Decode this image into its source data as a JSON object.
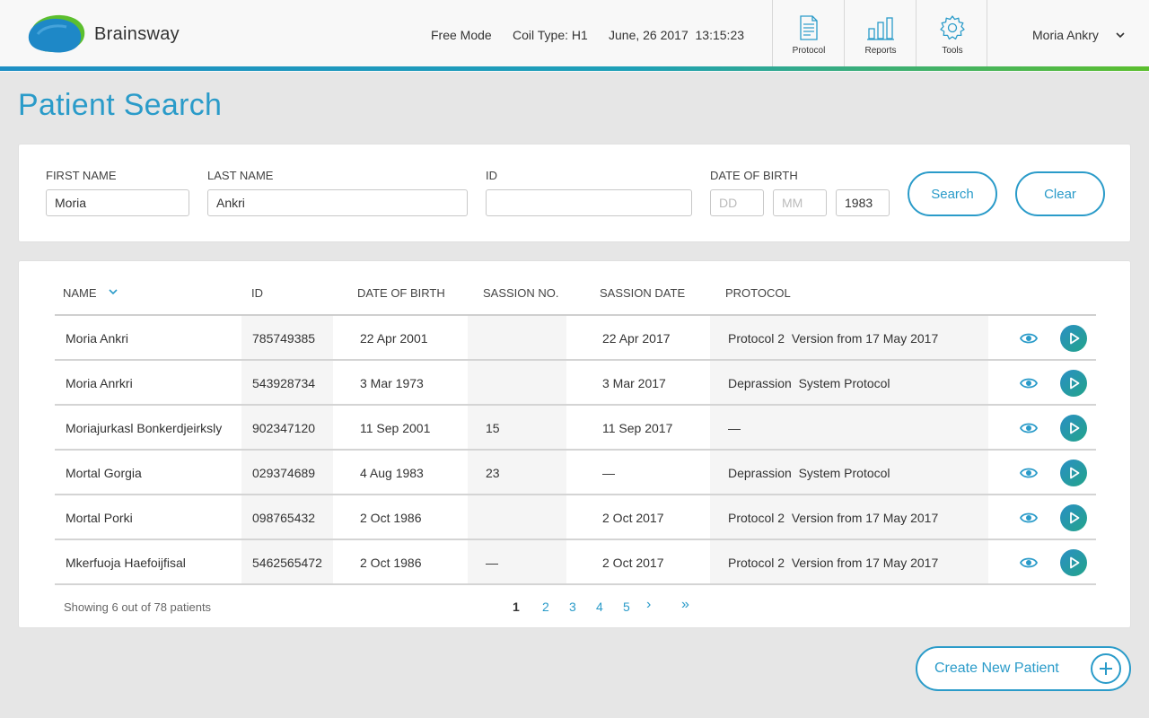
{
  "header": {
    "brand": "Brainsway",
    "mode": "Free Mode",
    "coil_type": "Coil Type: H1",
    "datetime": "June, 26 2017  13:15:23",
    "nav": [
      {
        "label": "Protocol",
        "icon": "document-icon"
      },
      {
        "label": "Reports",
        "icon": "bar-chart-icon"
      },
      {
        "label": "Tools",
        "icon": "gear-icon"
      }
    ],
    "user": "Moria Ankry"
  },
  "page_title": "Patient Search",
  "search": {
    "first_name": {
      "label": "FIRST NAME",
      "value": "Moria"
    },
    "last_name": {
      "label": "LAST NAME",
      "value": "Ankri"
    },
    "id": {
      "label": "ID",
      "value": ""
    },
    "dob": {
      "label": "DATE OF BIRTH",
      "dd_placeholder": "DD",
      "mm_placeholder": "MM",
      "year": "1983"
    },
    "search_label": "Search",
    "clear_label": "Clear"
  },
  "table": {
    "columns": [
      "NAME",
      "ID",
      "DATE OF BIRTH",
      "SASSION NO.",
      "SASSION DATE",
      "PROTOCOL"
    ],
    "rows": [
      {
        "name": "Moria Ankri",
        "id": "785749385",
        "dob": "22 Apr 2001",
        "session_no": "",
        "session_date": "22 Apr 2017",
        "protocol": "Protocol 2  Version from 17 May 2017"
      },
      {
        "name": "Moria Anrkri",
        "id": "543928734",
        "dob": "3 Mar 1973",
        "session_no": "",
        "session_date": "3 Mar 2017",
        "protocol": "Deprassion  System Protocol"
      },
      {
        "name": "Moriajurkasl Bonkerdjeirksly",
        "id": "902347120",
        "dob": "11 Sep 2001",
        "session_no": "15",
        "session_date": "11 Sep 2017",
        "protocol": "—"
      },
      {
        "name": "Mortal Gorgia",
        "id": "029374689",
        "dob": "4 Aug 1983",
        "session_no": "23",
        "session_date": "—",
        "protocol": "Deprassion  System Protocol"
      },
      {
        "name": "Mortal Porki",
        "id": "098765432",
        "dob": "2 Oct 1986",
        "session_no": "",
        "session_date": "2 Oct 2017",
        "protocol": "Protocol 2  Version from 17 May 2017"
      },
      {
        "name": "Mkerfuoja Haefoijfisal",
        "id": "5462565472",
        "dob": "2 Oct 1986",
        "session_no": "—",
        "session_date": "2 Oct 2017",
        "protocol": "Protocol 2  Version from 17 May 2017"
      }
    ]
  },
  "pagination": {
    "showing": "Showing 6 out of 78 patients",
    "pages": [
      "1",
      "2",
      "3",
      "4",
      "5"
    ],
    "current": "1",
    "next": "›",
    "last": "»"
  },
  "create_label": "Create New Patient",
  "colors": {
    "accent": "#2a9bc9",
    "green": "#5cbf2e",
    "teal": "#23a48a"
  }
}
